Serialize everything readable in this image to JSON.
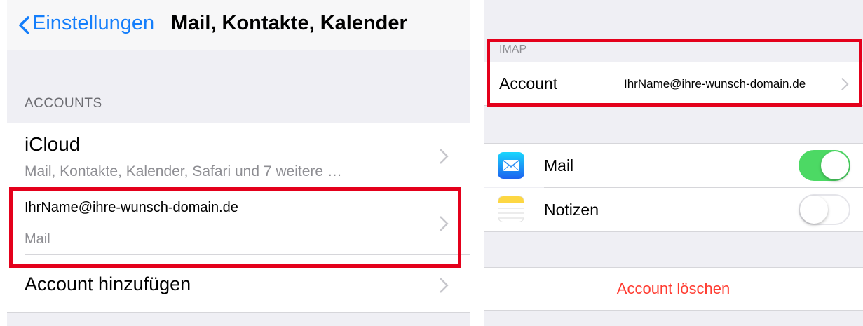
{
  "left": {
    "nav": {
      "back_label": "Einstellungen",
      "title": "Mail, Kontakte, Kalender"
    },
    "accounts_header": "ACCOUNTS",
    "icloud": {
      "title": "iCloud",
      "subtitle": "Mail, Kontakte, Kalender, Safari und 7 weitere …"
    },
    "custom_account": {
      "title": "IhrName@ihre-wunsch-domain.de",
      "subtitle": "Mail"
    },
    "add_account": "Account hinzufügen"
  },
  "right": {
    "section_header": "IMAP",
    "account": {
      "label": "Account",
      "value": "IhrName@ihre-wunsch-domain.de"
    },
    "services": [
      {
        "label": "Mail",
        "icon": "mail-app-icon",
        "enabled": true
      },
      {
        "label": "Notizen",
        "icon": "notes-app-icon",
        "enabled": false
      }
    ],
    "delete_label": "Account löschen"
  },
  "colors": {
    "ios_blue": "#147efb",
    "highlight_red": "#e4001b",
    "toggle_green": "#4cd964",
    "delete_red": "#ff3b30"
  }
}
